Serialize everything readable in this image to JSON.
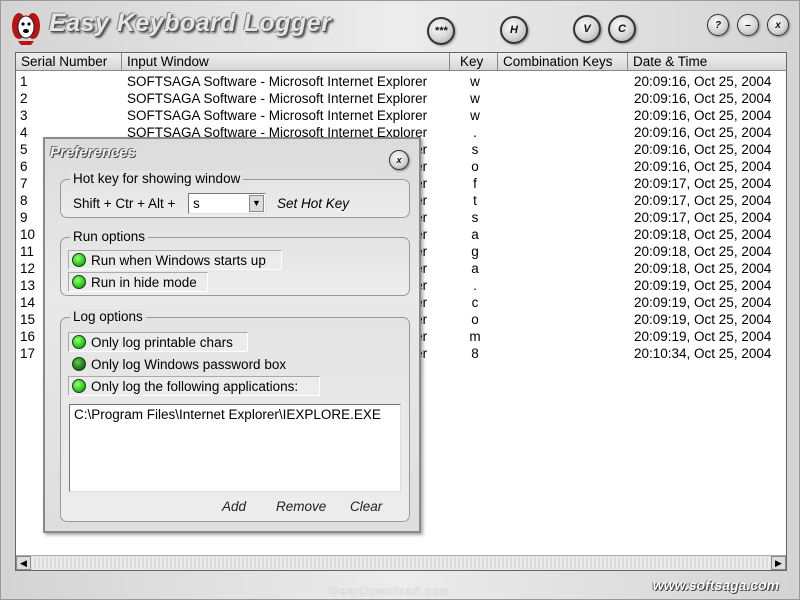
{
  "app": {
    "title": "Easy Keyboard Logger"
  },
  "toolbar": {
    "stars_label": "***",
    "h_label": "H",
    "v_label": "V",
    "c_label": "C",
    "help_label": "?",
    "min_label": "–",
    "close_label": "x"
  },
  "table": {
    "columns": [
      "Serial Number",
      "Input Window",
      "Key",
      "Combination Keys",
      "Date & Time"
    ],
    "rows": [
      {
        "serial": "1",
        "window": "SOFTSAGA Software - Microsoft Internet Explorer",
        "key": "w",
        "combo": "",
        "date": "20:09:16, Oct 25, 2004"
      },
      {
        "serial": "2",
        "window": "SOFTSAGA Software - Microsoft Internet Explorer",
        "key": "w",
        "combo": "",
        "date": "20:09:16, Oct 25, 2004"
      },
      {
        "serial": "3",
        "window": "SOFTSAGA Software - Microsoft Internet Explorer",
        "key": "w",
        "combo": "",
        "date": "20:09:16, Oct 25, 2004"
      },
      {
        "serial": "4",
        "window": "SOFTSAGA Software - Microsoft Internet Explorer",
        "key": ".",
        "combo": "",
        "date": "20:09:16, Oct 25, 2004"
      },
      {
        "serial": "5",
        "window": "SOFTSAGA Software - Microsoft Internet Explorer",
        "key": "s",
        "combo": "",
        "date": "20:09:16, Oct 25, 2004"
      },
      {
        "serial": "6",
        "window": "SOFTSAGA Software - Microsoft Internet Explorer",
        "key": "o",
        "combo": "",
        "date": "20:09:16, Oct 25, 2004"
      },
      {
        "serial": "7",
        "window": "SOFTSAGA Software - Microsoft Internet Explorer",
        "key": "f",
        "combo": "",
        "date": "20:09:17, Oct 25, 2004"
      },
      {
        "serial": "8",
        "window": "SOFTSAGA Software - Microsoft Internet Explorer",
        "key": "t",
        "combo": "",
        "date": "20:09:17, Oct 25, 2004"
      },
      {
        "serial": "9",
        "window": "SOFTSAGA Software - Microsoft Internet Explorer",
        "key": "s",
        "combo": "",
        "date": "20:09:17, Oct 25, 2004"
      },
      {
        "serial": "10",
        "window": "SOFTSAGA Software - Microsoft Internet Explorer",
        "key": "a",
        "combo": "",
        "date": "20:09:18, Oct 25, 2004"
      },
      {
        "serial": "11",
        "window": "SOFTSAGA Software - Microsoft Internet Explorer",
        "key": "g",
        "combo": "",
        "date": "20:09:18, Oct 25, 2004"
      },
      {
        "serial": "12",
        "window": "SOFTSAGA Software - Microsoft Internet Explorer",
        "key": "a",
        "combo": "",
        "date": "20:09:18, Oct 25, 2004"
      },
      {
        "serial": "13",
        "window": "SOFTSAGA Software - Microsoft Internet Explorer",
        "key": ".",
        "combo": "",
        "date": "20:09:19, Oct 25, 2004"
      },
      {
        "serial": "14",
        "window": "SOFTSAGA Software - Microsoft Internet Explorer",
        "key": "c",
        "combo": "",
        "date": "20:09:19, Oct 25, 2004"
      },
      {
        "serial": "15",
        "window": "SOFTSAGA Software - Microsoft Internet Explorer",
        "key": "o",
        "combo": "",
        "date": "20:09:19, Oct 25, 2004"
      },
      {
        "serial": "16",
        "window": "SOFTSAGA Software - Microsoft Internet Explorer",
        "key": "m",
        "combo": "",
        "date": "20:09:19, Oct 25, 2004"
      },
      {
        "serial": "17",
        "window": "SOFTSAGA Software - Microsoft Internet Explorer",
        "key": "8",
        "combo": "",
        "date": "20:10:34, Oct 25, 2004"
      }
    ]
  },
  "prefs": {
    "title": "Preferences",
    "close_label": "x",
    "hotkey": {
      "group_title": "Hot key for showing window",
      "modifier_label": "Shift + Ctr + Alt +",
      "key_value": "s",
      "set_label": "Set Hot Key"
    },
    "run": {
      "group_title": "Run options",
      "opt_startup": "Run when Windows starts up",
      "opt_hide": "Run in hide mode"
    },
    "log": {
      "group_title": "Log options",
      "opt_printable": "Only log printable chars",
      "opt_password": "Only log Windows password box",
      "opt_apps": "Only log the following applications:",
      "apps": [
        "C:\\Program Files\\Internet Explorer\\IEXPLORE.EXE"
      ],
      "add_label": "Add",
      "remove_label": "Remove",
      "clear_label": "Clear"
    }
  },
  "footer": {
    "url": "www.softsaga.com",
    "watermark": "GearDownload.com"
  },
  "scroll": {
    "left_arrow": "◀",
    "right_arrow": "▶"
  },
  "colors": {
    "led_on": "#2fcf22",
    "frame_gray": "#d4d4d4"
  }
}
